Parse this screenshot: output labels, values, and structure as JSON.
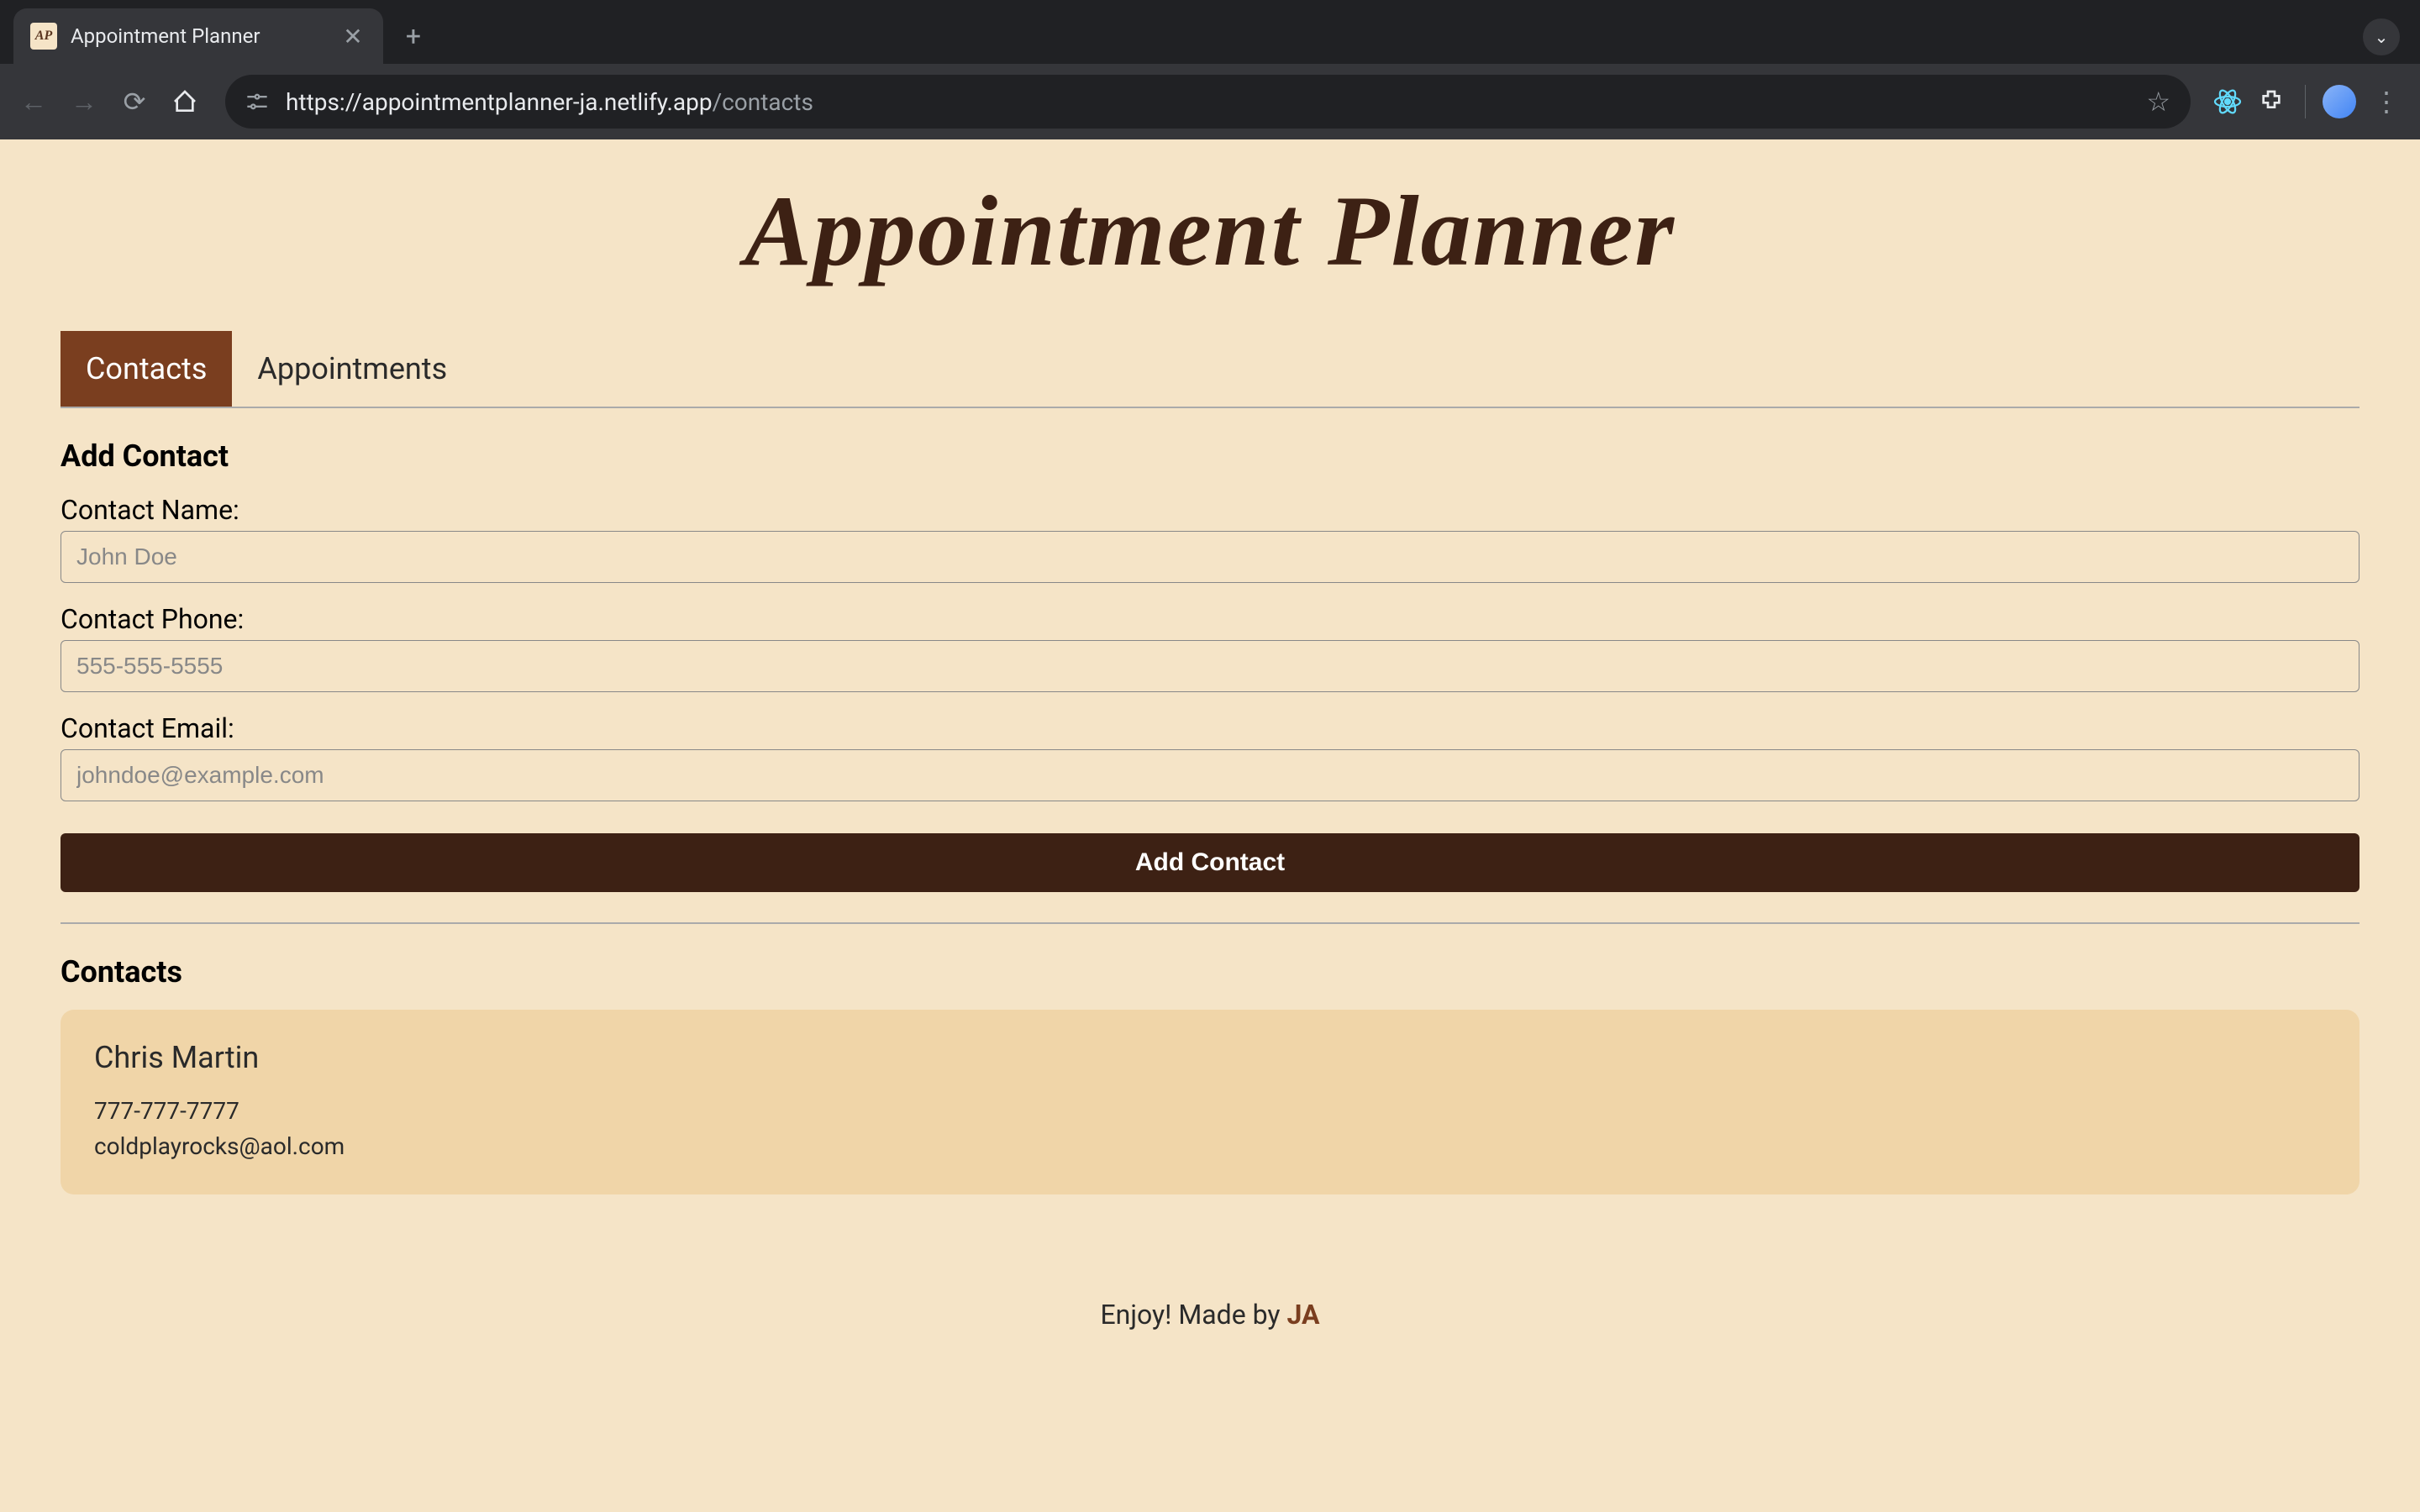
{
  "browser": {
    "tab_title": "Appointment Planner",
    "favicon_text": "AP",
    "url_host": "https://appointmentplanner-ja.netlify.app",
    "url_path": "/contacts"
  },
  "page": {
    "title": "Appointment Planner",
    "tabs": [
      {
        "label": "Contacts",
        "active": true
      },
      {
        "label": "Appointments",
        "active": false
      }
    ],
    "form": {
      "heading": "Add Contact",
      "fields": [
        {
          "label": "Contact Name:",
          "placeholder": "John Doe",
          "value": ""
        },
        {
          "label": "Contact Phone:",
          "placeholder": "555-555-5555",
          "value": ""
        },
        {
          "label": "Contact Email:",
          "placeholder": "johndoe@example.com",
          "value": ""
        }
      ],
      "submit_label": "Add Contact"
    },
    "contacts_heading": "Contacts",
    "contacts": [
      {
        "name": "Chris Martin",
        "phone": "777-777-7777",
        "email": "coldplayrocks@aol.com"
      }
    ],
    "footer": {
      "text": "Enjoy! Made by ",
      "author": "JA"
    }
  }
}
